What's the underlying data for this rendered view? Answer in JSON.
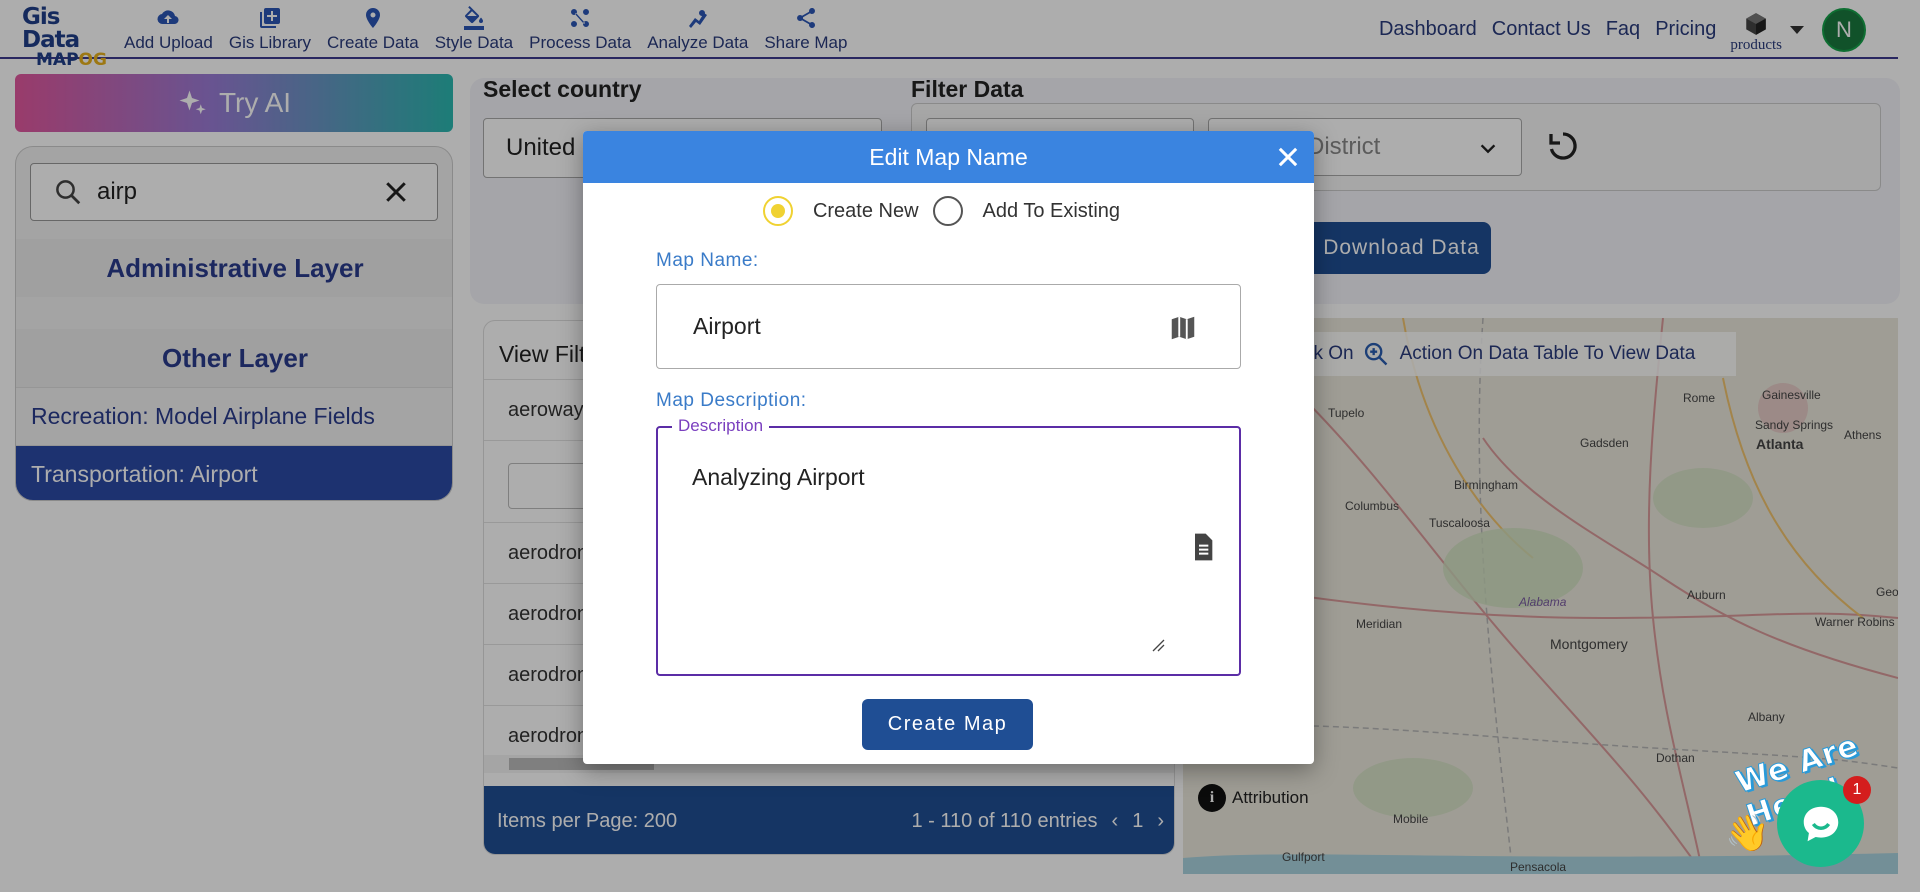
{
  "logo": {
    "line1": "Gis Data",
    "line2a": "MAP",
    "line2b": "OG"
  },
  "nav": {
    "items": [
      {
        "label": "Add Upload",
        "icon": "cloud-upload-icon"
      },
      {
        "label": "Gis Library",
        "icon": "library-add-icon"
      },
      {
        "label": "Create Data",
        "icon": "map-pin-icon"
      },
      {
        "label": "Style Data",
        "icon": "paint-bucket-icon"
      },
      {
        "label": "Process Data",
        "icon": "process-nodes-icon"
      },
      {
        "label": "Analyze Data",
        "icon": "analyze-icon"
      },
      {
        "label": "Share Map",
        "icon": "share-icon"
      }
    ],
    "links": {
      "dashboard": "Dashboard",
      "contact": "Contact Us",
      "faq": "Faq",
      "pricing": "Pricing"
    },
    "products": "products",
    "avatar": "N"
  },
  "left": {
    "try_ai": "Try AI",
    "search_value": "airp",
    "admin_layer": "Administrative Layer",
    "other_layer": "Other Layer",
    "items": [
      "Recreation: Model Airplane Fields",
      "Transportation: Airport"
    ]
  },
  "controls": {
    "select_country_label": "Select country",
    "country_value": "United",
    "filter_label": "Filter Data",
    "district_placeholder": "District",
    "download_label": "Download Data"
  },
  "table": {
    "title": "View Filt",
    "rows": [
      "aeroway",
      "aerodron",
      "aerodron",
      "aerodron",
      "aerodron"
    ],
    "items_per_page": "Items per Page: 200",
    "range": "1 - 110 of 110 entries",
    "page": "1"
  },
  "map": {
    "tip_part1": "ck On",
    "tip_part2": "Action On Data Table To View Data",
    "attribution": "Attribution",
    "cities": [
      "Gainesville",
      "Rome",
      "Tupelo",
      "Sandy Springs",
      "Athens",
      "Gadsden",
      "Atlanta",
      "Birmingham",
      "Columbus",
      "Tuscaloosa",
      "Alabama",
      "Auburn",
      "Meridian",
      "Montgomery",
      "Warner Robins",
      "Georg",
      "Albany",
      "Dothan",
      "Mobile",
      "Gulfport",
      "Pensacola"
    ]
  },
  "modal": {
    "title": "Edit Map Name",
    "radio_new": "Create New",
    "radio_existing": "Add To Existing",
    "map_name_label": "Map Name:",
    "map_name_value": "Airport",
    "desc_label": "Map Description:",
    "desc_legend": "Description",
    "desc_value": "Analyzing Airport",
    "create_button": "Create Map"
  },
  "chat": {
    "banner": "We Are Here!",
    "badge": "1"
  }
}
